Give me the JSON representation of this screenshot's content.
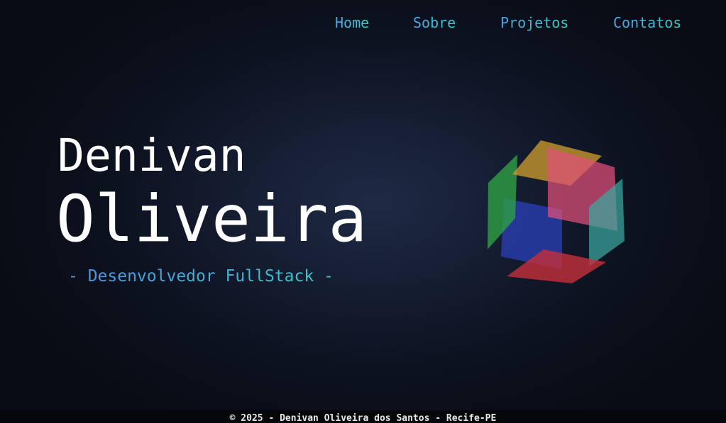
{
  "nav": {
    "items": [
      {
        "label": "Home"
      },
      {
        "label": "Sobre"
      },
      {
        "label": "Projetos"
      },
      {
        "label": "Contatos"
      }
    ],
    "colors": {
      "gradient_start": "#4aa3e8",
      "gradient_end": "#37d0c4"
    }
  },
  "hero": {
    "first_name": "Denivan",
    "last_name": "Oliveira",
    "subtitle": "- Desenvolvedor FullStack -",
    "cube_faces": [
      {
        "name": "green",
        "color": "#2ea043"
      },
      {
        "name": "yellow",
        "color": "#c99a2e"
      },
      {
        "name": "pink",
        "color": "#e0507a"
      },
      {
        "name": "blue",
        "color": "#2a40b8"
      },
      {
        "name": "teal",
        "color": "#3aa8a0"
      },
      {
        "name": "red",
        "color": "#c4303a"
      }
    ]
  },
  "footer": {
    "text": "© 2025 - Denivan Oliveira dos Santos - Recife-PE"
  }
}
